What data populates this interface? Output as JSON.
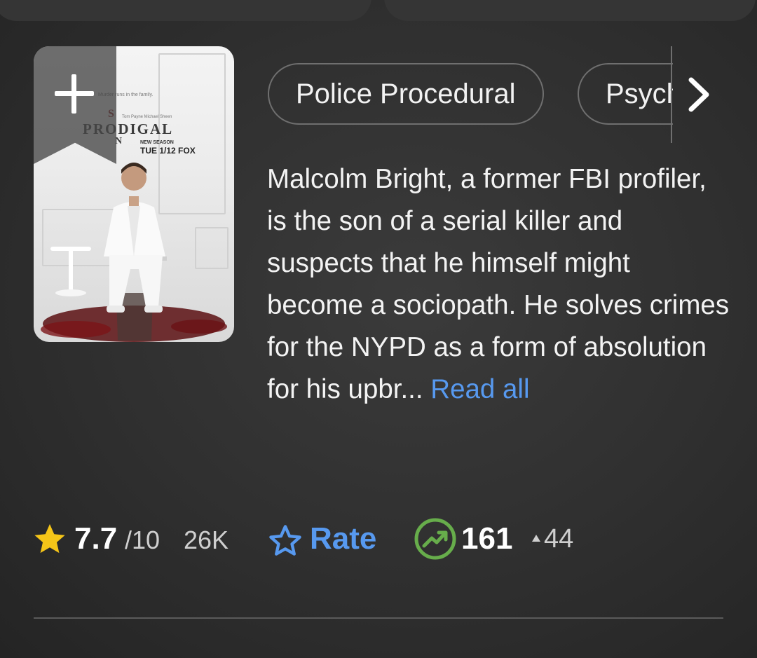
{
  "poster": {
    "tagline": "Murder runs in the family.",
    "credits": "Tom Payne   Michael Sheen",
    "series_title": "PRODIGAL",
    "vertical_letters": [
      "S",
      "O",
      "N"
    ],
    "air_label": "NEW SEASON",
    "air_date": "TUE 1/12 FOX",
    "watchlist_icon": "plus-icon"
  },
  "genres": [
    "Police Procedural",
    "Psychological"
  ],
  "plot": {
    "text": "Malcolm Bright, a former FBI profiler, is the son of a serial killer and suspects that he himself might become a sociopath. He solves crimes for the NYPD as a form of absolution for his upbr... ",
    "read_all": "Read all"
  },
  "rating": {
    "value": "7.7",
    "max": "/10",
    "votes": "26K",
    "star_color": "#f5c518",
    "icon": "star-icon"
  },
  "rate": {
    "label": "Rate",
    "icon": "star-outline-icon",
    "color": "#5799ef"
  },
  "popularity": {
    "rank": "161",
    "change": "44",
    "direction": "up",
    "icon": "trending-up-icon",
    "color": "#67ad4b"
  }
}
